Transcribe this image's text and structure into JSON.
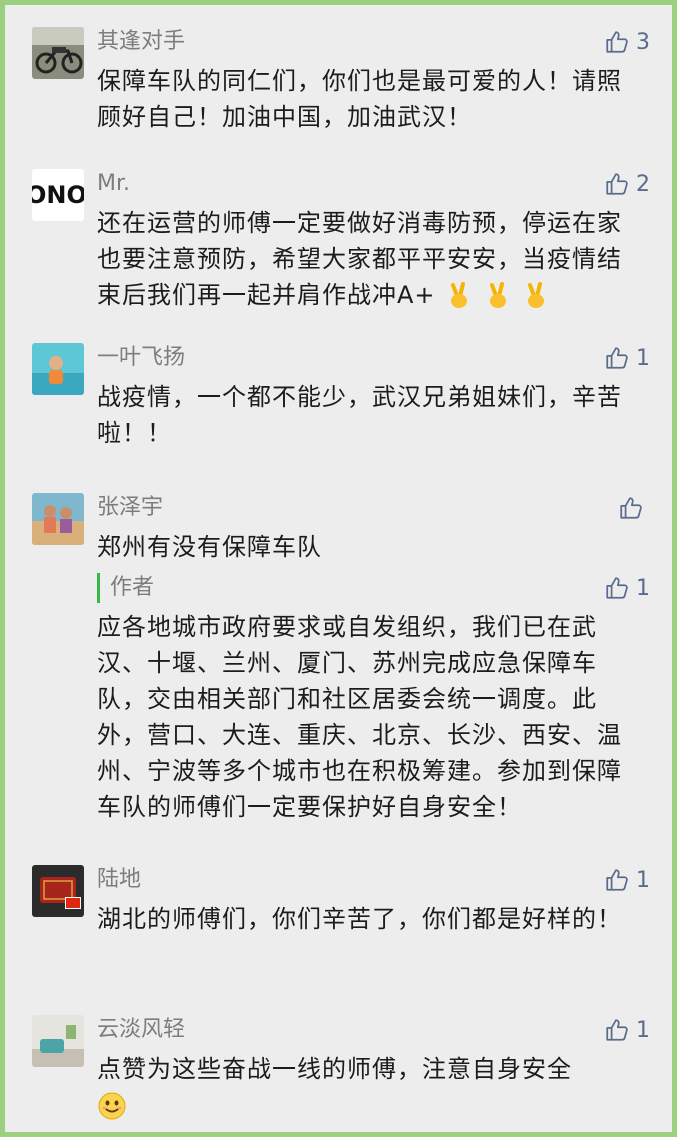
{
  "comments": [
    {
      "name": "其逢对手",
      "likes": "3",
      "text": "保障车队的同仁们，你们也是最可爱的人！请照顾好自己！加油中国，加油武汉！",
      "avatar": "motorcycle-photo"
    },
    {
      "name": "Mr.",
      "likes": "2",
      "text": "还在运营的师傅一定要做好消毒防预，停运在家也要注意预防，希望大家都平平安安，当疫情结束后我们再一起并肩作战冲A+",
      "emojis": [
        "victory-hand-icon",
        "victory-hand-icon",
        "victory-hand-icon"
      ],
      "avatar": "pono-logo"
    },
    {
      "name": "一叶飞扬",
      "likes": "1",
      "text": "战疫情，一个都不能少，武汉兄弟姐妹们，辛苦啦！！",
      "avatar": "child-pool-photo"
    },
    {
      "name": "张泽宇",
      "likes": "",
      "text": "郑州有没有保障车队",
      "avatar": "beach-photo",
      "reply": {
        "label": "作者",
        "likes": "1",
        "text": "应各地城市政府要求或自发组织，我们已在武汉、十堰、兰州、厦门、苏州完成应急保障车队，交由相关部门和社区居委会统一调度。此外，营口、大连、重庆、北京、长沙、西安、温州、宁波等多个城市也在积极筹建。参加到保障车队的师傅们一定要保护好自身安全！"
      }
    },
    {
      "name": "陆地",
      "likes": "1",
      "text": "湖北的师傅们，你们辛苦了，你们都是好样的！",
      "avatar": "red-box-photo"
    },
    {
      "name": "云淡风轻",
      "likes": "1",
      "text": "点赞为这些奋战一线的师傅，注意自身安全",
      "emojis": [
        "smiling-face-icon"
      ],
      "avatar": "living-room-photo"
    }
  ],
  "colors": {
    "border": "#9bd07f",
    "background": "#ededed",
    "name": "#7d7d7d",
    "like": "#5b6b8c",
    "author_bar": "#39b54a"
  }
}
